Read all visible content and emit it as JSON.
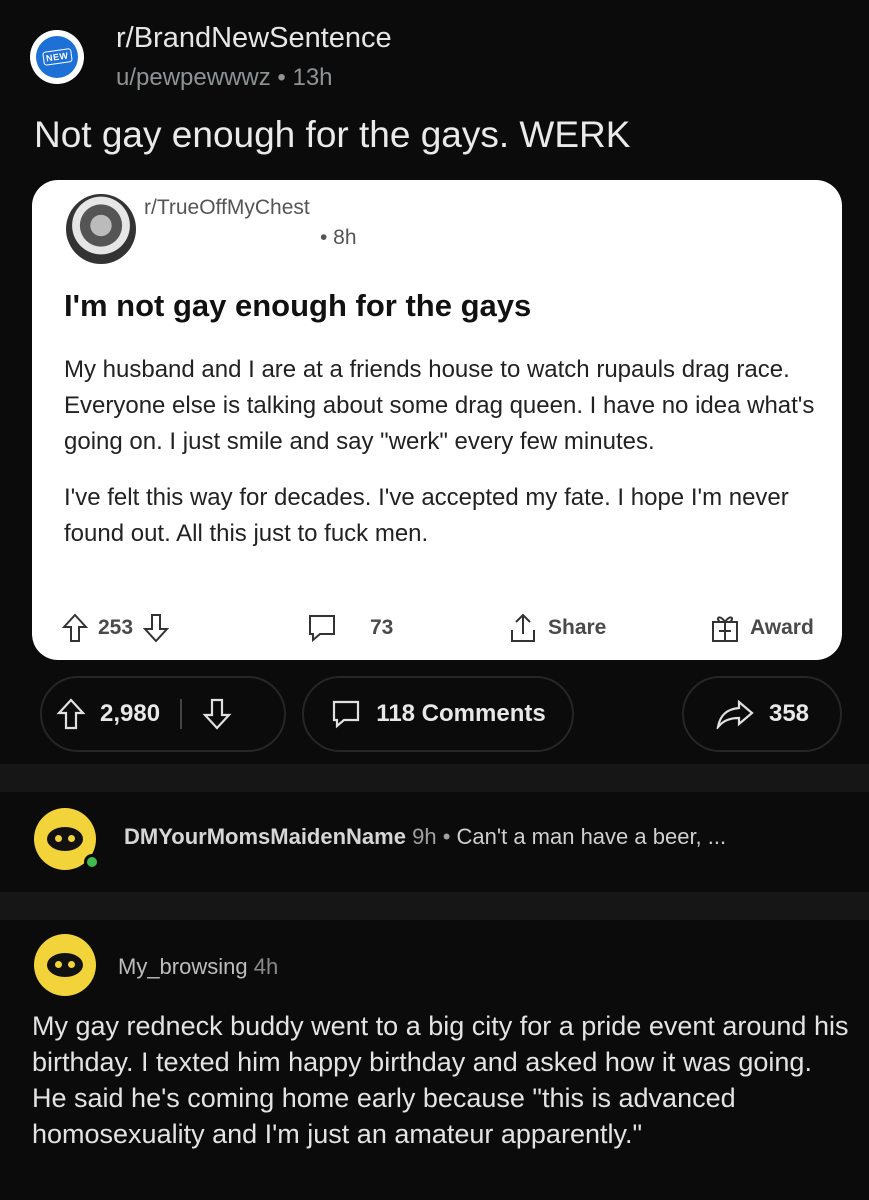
{
  "header": {
    "subreddit": "r/BrandNewSentence",
    "avatar_badge": "NEW",
    "user": "u/pewpewwwz",
    "separator": "•",
    "time": "13h"
  },
  "post": {
    "title": "Not gay enough for the gays. WERK"
  },
  "embedded": {
    "subreddit": "r/TrueOffMyChest",
    "time": "• 8h",
    "title": "I'm not gay enough for the gays",
    "paragraphs": [
      "My husband and I are at a friends house to watch rupauls drag race. Everyone else is talking about some drag queen. I have no idea what's going on. I just smile and say \"werk\" every few minutes.",
      "I've felt this way for decades. I've accepted my fate. I hope I'm never found out. All this just to fuck men."
    ],
    "upvotes": "253",
    "comments": "73",
    "share_label": "Share",
    "award_label": "Award"
  },
  "actions": {
    "score": "2,980",
    "comments_label": "118 Comments",
    "shares": "358"
  },
  "comments": [
    {
      "user": "DMYourMomsMaidenName",
      "time": "9h",
      "separator": "•",
      "preview": "Can't a man have a beer, ..."
    },
    {
      "user": "My_browsing",
      "time": "4h",
      "body": "My gay redneck buddy went to a big city for a pride event around his birthday.  I texted him happy birthday and asked how it was going.  He said he's coming home early because \"this is advanced homosexuality and I'm just an amateur apparently.\""
    }
  ]
}
